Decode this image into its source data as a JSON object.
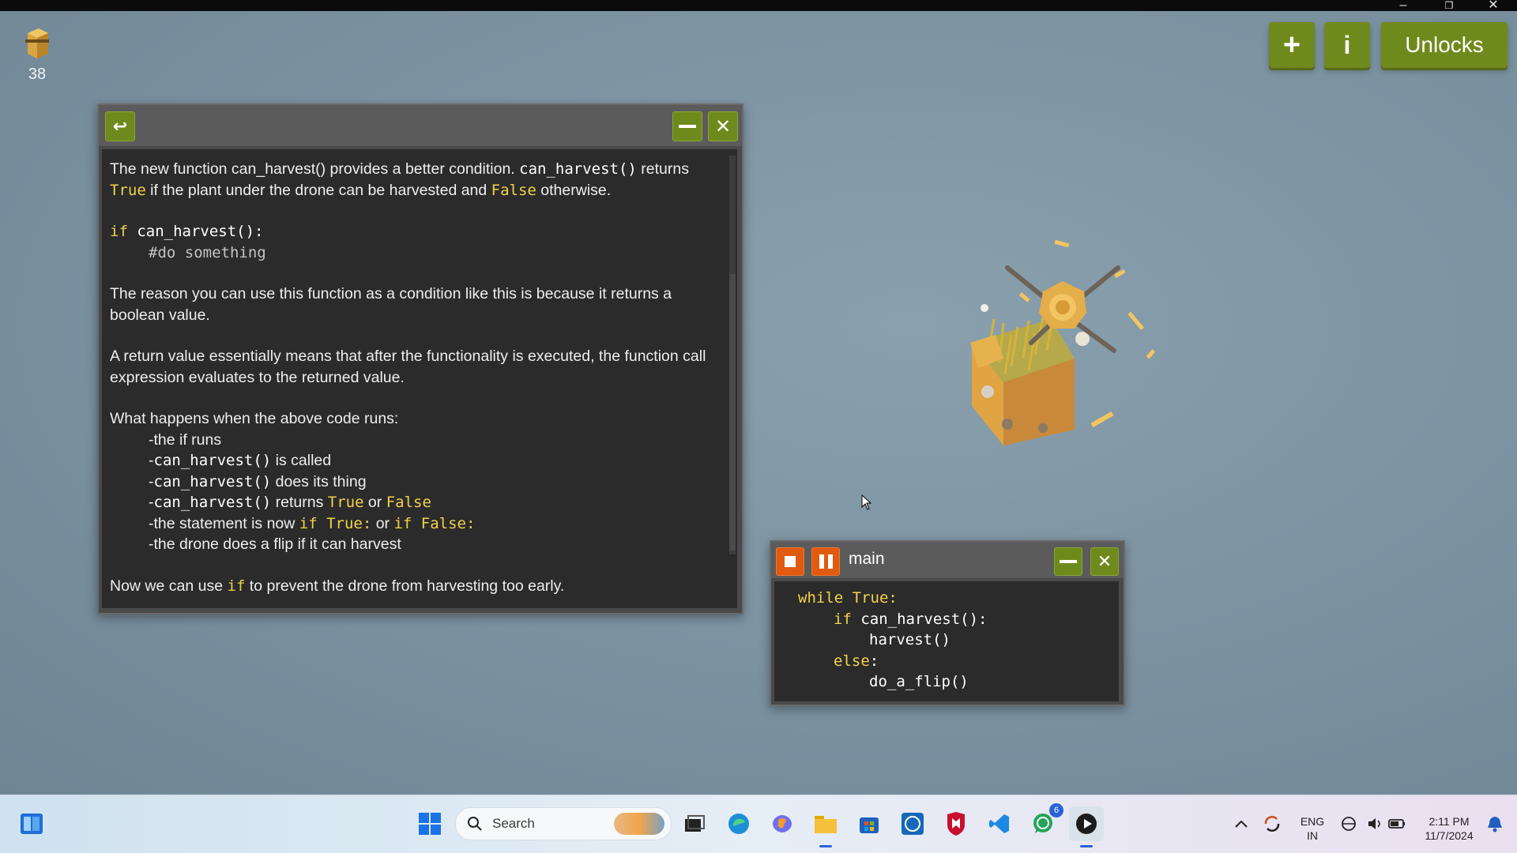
{
  "window": {
    "minimize": "–",
    "restore": "❐",
    "close": "✕"
  },
  "resource": {
    "count": "38",
    "icon": "hay-bundle-icon"
  },
  "top_buttons": {
    "add_label": "+",
    "info_label": "i",
    "unlocks_label": "Unlocks"
  },
  "info_panel": {
    "back_icon": "↩",
    "close_icon": "✕",
    "p1_a": "The new function can_harvest() provides a better condition. ",
    "p1_code": "can_harvest()",
    "p1_b": " returns ",
    "p1_true": "True",
    "p1_c": " if the plant under the drone can be harvested and ",
    "p1_false": "False",
    "p1_d": " otherwise.",
    "code_if": "if",
    "code_cond": " can_harvest():",
    "code_comment": "#do something",
    "p2": "The reason you can use this function as a condition like this is because it returns a boolean value.",
    "p3": "A return value essentially means that after the functionality is executed, the function call expression evaluates to the returned value.",
    "p4": "What happens when the above code runs:",
    "steps": {
      "s1": "-the if runs",
      "s2_pre": "-",
      "s2_code": "can_harvest()",
      "s2_post": " is called",
      "s3_pre": "-",
      "s3_code": "can_harvest()",
      "s3_post": " does its thing",
      "s4_pre": "-",
      "s4_code": "can_harvest()",
      "s4_mid": " returns ",
      "s4_true": "True",
      "s4_or": " or ",
      "s4_false": "False",
      "s5_pre": "-the statement is now ",
      "s5_if1": "if True:",
      "s5_or": " or ",
      "s5_if2": "if False:",
      "s6": "-the drone does a flip if it can harvest"
    },
    "p5_a": "Now we can use ",
    "p5_if": "if",
    "p5_b": " to prevent the drone from harvesting too early."
  },
  "code_window": {
    "name": "main",
    "close_icon": "✕",
    "lines": {
      "l1_kw": "while",
      "l1_val": " True",
      "l1_end": ":",
      "l2_kw": "if",
      "l2_rest": " can_harvest():",
      "l3": "harvest()",
      "l4_kw": "else",
      "l4_end": ":",
      "l5": "do_a_flip()"
    }
  },
  "taskbar": {
    "search_placeholder": "Search",
    "lang_top": "ENG",
    "lang_bottom": "IN",
    "time": "2:11 PM",
    "date": "11/7/2024",
    "whatsapp_badge": "6"
  },
  "colors": {
    "accent_green": "#6f8a1c",
    "accent_orange": "#e05a10",
    "keyword_yellow": "#f2d24a"
  }
}
